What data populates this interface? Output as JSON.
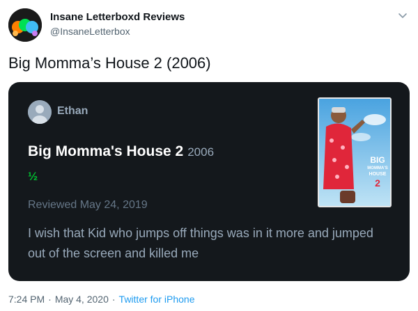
{
  "account": {
    "name": "Insane Letterboxd Reviews",
    "handle": "@InsaneLetterbox"
  },
  "tweet": {
    "text": "Big Momma’s House 2 (2006)",
    "time": "7:24 PM",
    "date": "May 4, 2020",
    "source": "Twitter for iPhone",
    "separator": "·"
  },
  "card": {
    "reviewer_name": "Ethan",
    "film_title": "Big Momma's House 2",
    "film_year": "2006",
    "rating": "½",
    "reviewed_date": "Reviewed May 24, 2019",
    "review_text": "I wish that Kid who jumps off things was in it more and jumped out of the screen and killed me",
    "poster_text": [
      "BIG",
      "MOMMA'S",
      "HOUSE",
      "2"
    ]
  },
  "colors": {
    "card_bg": "#14181c",
    "rating_green": "#00c030",
    "link_blue": "#1d9bf0",
    "muted_text": "#99aabb"
  },
  "icons": {
    "account_avatar": "letterboxd-dots-avatar",
    "menu": "chevron-down-icon",
    "reviewer_avatar": "user-silhouette-icon"
  }
}
